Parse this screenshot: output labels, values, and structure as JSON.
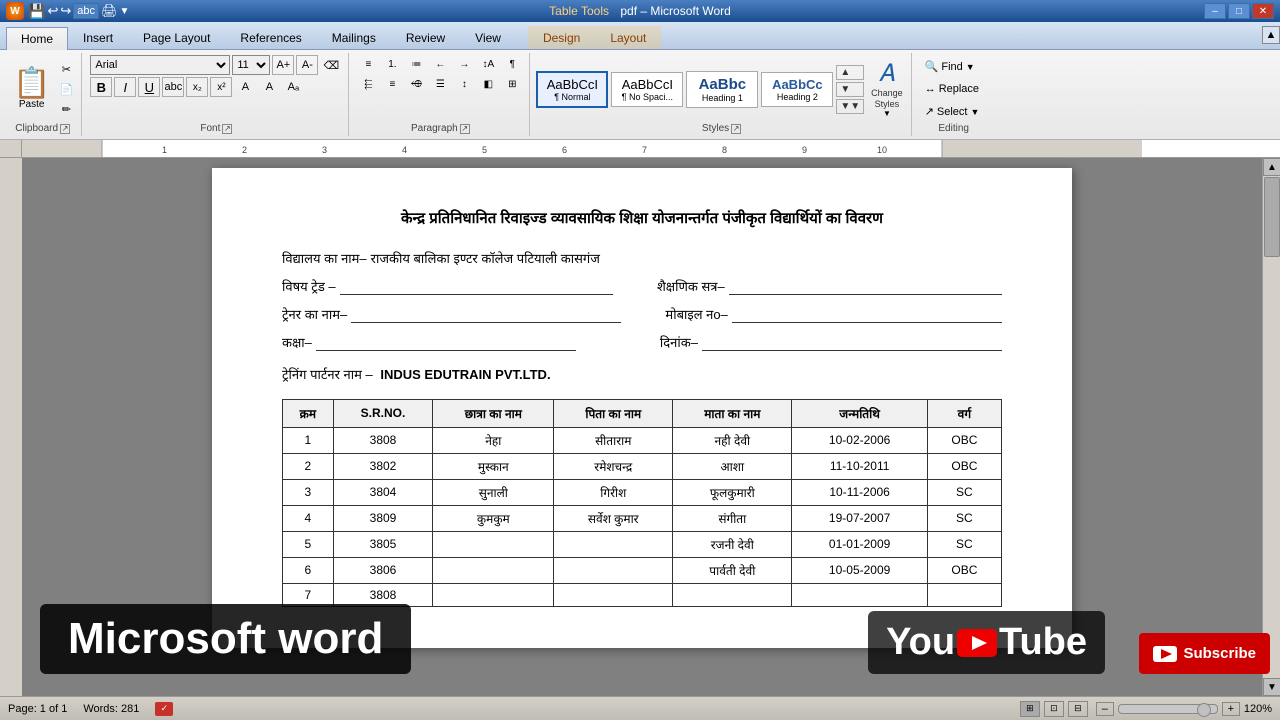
{
  "titlebar": {
    "title": "pdf – Microsoft Word",
    "context_tool": "Table Tools",
    "buttons": [
      "–",
      "□",
      "✕"
    ]
  },
  "quickaccess": {
    "buttons": [
      "↩",
      "↪",
      "ABC",
      "💾",
      "🖨",
      "▼"
    ]
  },
  "ribbon": {
    "tabs": [
      "Home",
      "Insert",
      "Page Layout",
      "References",
      "Mailings",
      "Review",
      "View",
      "Design",
      "Layout"
    ],
    "active_tab": "Home",
    "groups": {
      "clipboard": {
        "label": "Clipboard",
        "paste": "Paste",
        "buttons": [
          "✂",
          "📋",
          "✏"
        ]
      },
      "font": {
        "label": "Font",
        "font_name": "Arial",
        "font_size": "11",
        "format_buttons": [
          "B",
          "I",
          "U",
          "abc",
          "x₂",
          "x²",
          "A",
          "A",
          "A"
        ]
      },
      "paragraph": {
        "label": "Paragraph",
        "list_buttons": [
          "≡",
          "1.",
          "≔",
          "←",
          "→",
          "↕",
          "¶"
        ],
        "align_buttons": [
          "≡L",
          "≡C",
          "≡R",
          "≡J"
        ],
        "other_buttons": [
          "↕",
          "◫",
          "░"
        ]
      },
      "styles": {
        "label": "Styles",
        "items": [
          {
            "label": "AaBbCcl",
            "sublabel": "¶ Normal",
            "active": true
          },
          {
            "label": "AaBbCcl",
            "sublabel": "¶ No Spaci..."
          },
          {
            "label": "AaBbc",
            "sublabel": "Heading 1"
          },
          {
            "label": "AaBbCc",
            "sublabel": "Heading 2"
          }
        ],
        "change_styles_label": "Change\nStyles"
      },
      "editing": {
        "label": "Editing",
        "buttons": [
          {
            "label": "Find",
            "icon": "🔍"
          },
          {
            "label": "Replace",
            "icon": "↔"
          },
          {
            "label": "Select",
            "icon": "↗"
          }
        ]
      }
    }
  },
  "document": {
    "title": "केन्द्र प्रतिनिधानित रिवाइज्ड व्यावसायिक शिक्षा योजनान्तर्गत पंजीकृत विद्यार्थियों का विवरण",
    "school_label": "विद्यालय का नाम–",
    "school_value": "राजकीय बालिका इण्टर कॉलेज पटियाली कासगंज",
    "subject_label": "विषय ट्रेड –",
    "session_label": "शैक्षणिक सत्र–",
    "trainer_label": "ट्रेनर का नाम–",
    "mobile_label": "मोबाइल नo–",
    "class_label": "कक्षा–",
    "date_label": "दिनांक–",
    "partner_label": "ट्रेनिंग पार्टनर नाम –",
    "partner_value": "INDUS EDUTRAIN PVT.LTD.",
    "table": {
      "headers": [
        "क्रम",
        "S.R.NO.",
        "छात्रा का नाम",
        "पिता का नाम",
        "माता का नाम",
        "जन्मतिथि",
        "वर्ग"
      ],
      "rows": [
        [
          "1",
          "3808",
          "नेहा",
          "सीताराम",
          "नही देवी",
          "10-02-2006",
          "OBC"
        ],
        [
          "2",
          "3802",
          "मुस्कान",
          "रमेशचन्द्र",
          "आशा",
          "11-10-2011",
          "OBC"
        ],
        [
          "3",
          "3804",
          "सुनाली",
          "गिरीश",
          "फूलकुमारी",
          "10-11-2006",
          "SC"
        ],
        [
          "4",
          "3809",
          "कुमकुम",
          "सर्वेश कुमार",
          "संगीता",
          "19-07-2007",
          "SC"
        ],
        [
          "5",
          "3805",
          "",
          "",
          "रजनी देवी",
          "01-01-2009",
          "SC"
        ],
        [
          "6",
          "3806",
          "",
          "",
          "पार्वती देवी",
          "10-05-2009",
          "OBC"
        ],
        [
          "7",
          "3808",
          "",
          "",
          "",
          "",
          ""
        ]
      ]
    }
  },
  "statusbar": {
    "page_info": "Page: 1 of 1",
    "word_count": "Words: 281",
    "zoom": "120%"
  },
  "banner_ms": "Microsoft word",
  "banner_yt_text": "You",
  "banner_tube": "Tube",
  "banner_subscribe": "Subscribe"
}
